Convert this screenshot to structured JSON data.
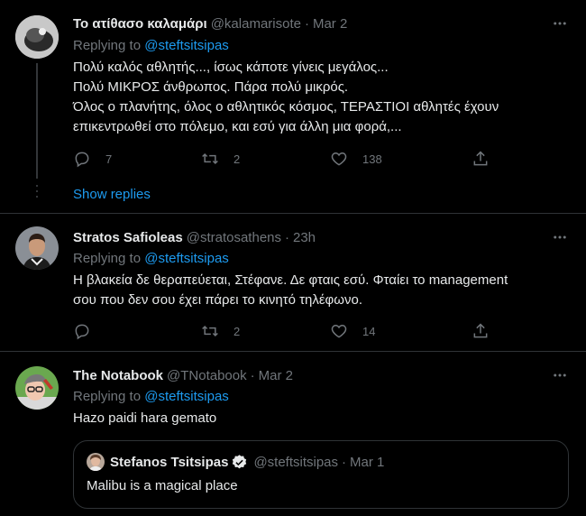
{
  "tweets": [
    {
      "name": "Το ατίθασο καλαμάρι",
      "handle": "@kalamarisote",
      "dot": "·",
      "time": "Mar 2",
      "replying_prefix": "Replying to ",
      "replying_to": "@steftsitsipas",
      "lines": [
        "Πολύ καλός αθλητής..., ίσως κάποτε γίνεις μεγάλος...",
        "Πολύ ΜΙΚΡΟΣ άνθρωπος. Πάρα πολύ μικρός.",
        "Όλος ο πλανήτης, όλος ο αθλητικός κόσμος, ΤΕΡΑΣΤΙΟΙ αθλητές έχουν",
        "επικεντρωθεί στο πόλεμο, και εσύ για άλλη μια φορά,..."
      ],
      "replies": "7",
      "retweets": "2",
      "likes": "138"
    },
    {
      "name": "Stratos Safioleas",
      "handle": "@stratosathens",
      "dot": "·",
      "time": "23h",
      "replying_prefix": "Replying to ",
      "replying_to": "@steftsitsipas",
      "lines": [
        "Η βλακεία δε θεραπεύεται, Στέφανε. Δε φταις εσύ. Φταίει το management",
        "σου που δεν σου έχει πάρει το κινητό τηλέφωνο."
      ],
      "replies": "",
      "retweets": "2",
      "likes": "14"
    },
    {
      "name": "The Notabook",
      "handle": "@TNotabook",
      "dot": "·",
      "time": "Mar 2",
      "replying_prefix": "Replying to ",
      "replying_to": "@steftsitsipas",
      "lines": [
        "Hazo paidi hara gemato"
      ]
    }
  ],
  "show_replies": "Show replies",
  "quote": {
    "name": "Stefanos Tsitsipas",
    "handle": "@steftsitsipas",
    "dot": "·",
    "time": "Mar 1",
    "text": "Malibu is a magical place"
  },
  "icons": {
    "reply": "reply-icon",
    "retweet": "retweet-icon",
    "like": "heart-icon",
    "share": "share-icon",
    "more": "more-icon",
    "verified": "verified-badge-icon"
  },
  "colors": {
    "background": "#000000",
    "text": "#e7e9ea",
    "muted": "#71767b",
    "link": "#1d9bf0",
    "divider": "#2f3336"
  }
}
